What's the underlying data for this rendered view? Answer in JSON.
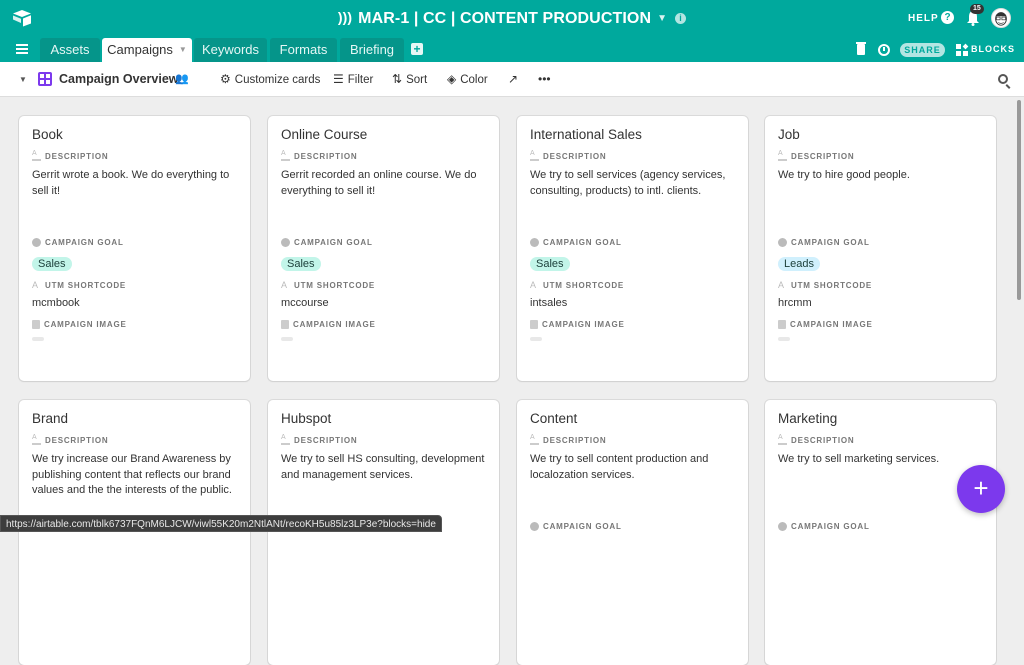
{
  "header": {
    "base_title": "MAR-1 | CC | CONTENT PRODUCTION",
    "help_label": "HELP",
    "notification_count": "15",
    "accent_color": "#00a99d"
  },
  "tabs": [
    {
      "label": "Assets",
      "active": false
    },
    {
      "label": "Campaigns",
      "active": true
    },
    {
      "label": "Keywords",
      "active": false
    },
    {
      "label": "Formats",
      "active": false
    },
    {
      "label": "Briefing",
      "active": false
    }
  ],
  "toolbar_right": {
    "share_label": "SHARE",
    "blocks_label": "BLOCKS"
  },
  "viewbar": {
    "view_name": "Campaign Overview",
    "customize_label": "Customize cards",
    "filter_label": "Filter",
    "sort_label": "Sort",
    "color_label": "Color"
  },
  "field_labels": {
    "description": "DESCRIPTION",
    "goal": "CAMPAIGN GOAL",
    "utm": "UTM SHORTCODE",
    "image": "CAMPAIGN IMAGE"
  },
  "goal_colors": {
    "Sales": "#c2f5e9",
    "Leads": "#d0f0fd"
  },
  "cards": [
    {
      "title": "Book",
      "description": "Gerrit wrote a book. We do everything to sell it!",
      "goal": "Sales",
      "utm": "mcmbook"
    },
    {
      "title": "Online Course",
      "description": "Gerrit recorded an online course. We do everything to sell it!",
      "goal": "Sales",
      "utm": "mccourse"
    },
    {
      "title": "International Sales",
      "description": "We try to sell services (agency services, consulting, products) to intl. clients.",
      "goal": "Sales",
      "utm": "intsales"
    },
    {
      "title": "Job",
      "description": "We try to hire good people.",
      "goal": "Leads",
      "utm": "hrcmm"
    },
    {
      "title": "Brand",
      "description": "We try increase our Brand Awareness by publishing content that reflects our brand values and the the interests of the public."
    },
    {
      "title": "Hubspot",
      "description": "We try to sell HS consulting, development and management services."
    },
    {
      "title": "Content",
      "description": "We try to sell content production and localozation services."
    },
    {
      "title": "Marketing",
      "description": "We try to sell marketing services."
    }
  ],
  "status_url": "https://airtable.com/tblk6737FQnM6LJCW/viwl55K20m2NtlANt/recoKH5u85lz3LP3e?blocks=hide",
  "fab_label": "+"
}
